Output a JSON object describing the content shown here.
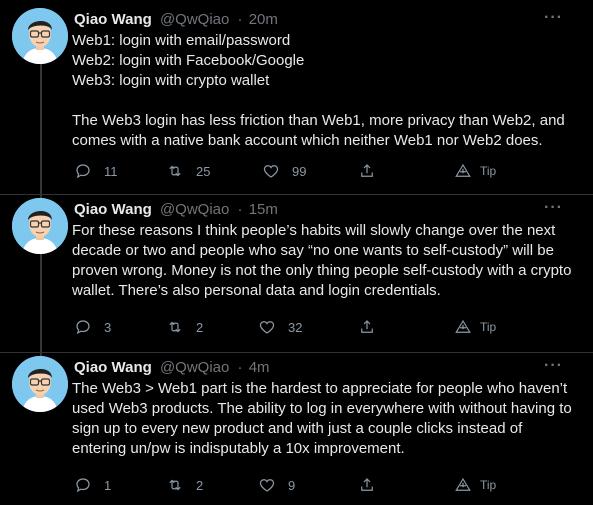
{
  "tweets": [
    {
      "name": "Qiao Wang",
      "handle": "@QwQiao",
      "time": "20m",
      "lines": [
        "Web1: login with email/password",
        "Web2: login with Facebook/Google",
        "Web3: login with crypto wallet",
        "",
        "The Web3 login has less friction than Web1, more privacy than Web2, and",
        "comes with a native bank account which neither Web1 nor Web2 does."
      ],
      "reply_count": "11",
      "retweet_count": "25",
      "like_count": "99",
      "tip_label": "Tip"
    },
    {
      "name": "Qiao Wang",
      "handle": "@QwQiao",
      "time": "15m",
      "lines": [
        "For these reasons I think people’s habits will slowly change over the next",
        "decade or two and people who say “no one wants to self-custody” will be",
        "proven wrong. Money is not the only thing people self-custody with a crypto",
        "wallet. There’s also personal data and login credentials."
      ],
      "reply_count": "3",
      "retweet_count": "2",
      "like_count": "32",
      "tip_label": "Tip"
    },
    {
      "name": "Qiao Wang",
      "handle": "@QwQiao",
      "time": "4m",
      "lines": [
        "The Web3 > Web1 part is the hardest to appreciate for people who haven’t",
        "used Web3 products. The ability to log in everywhere with without having to",
        "sign up to every new product and with just a couple clicks instead of",
        "entering un/pw is indisputably a 10x improvement."
      ],
      "reply_count": "1",
      "retweet_count": "2",
      "like_count": "9",
      "tip_label": "Tip"
    }
  ],
  "separator": "·",
  "more_glyph": "···",
  "colors": {
    "background": "#000000",
    "text": "#e7e9ea",
    "muted": "#71767b",
    "thread_line": "#333639"
  }
}
